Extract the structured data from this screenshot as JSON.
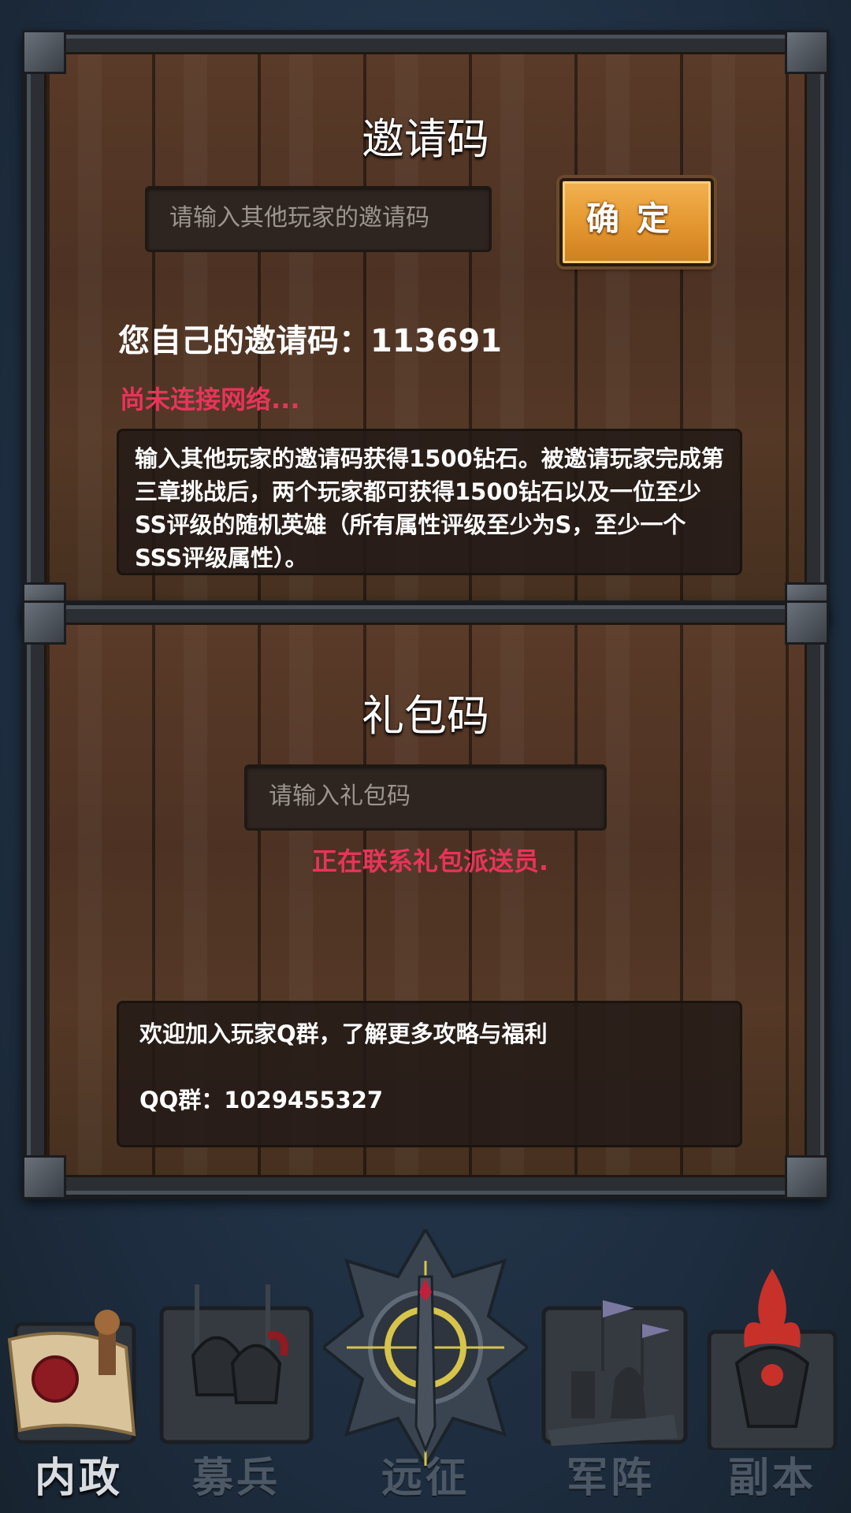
{
  "invite": {
    "title": "邀请码",
    "input_placeholder": "请输入其他玩家的邀请码",
    "confirm_label": "确定",
    "own_code_label": "您自己的邀请码：",
    "own_code_value": "113691",
    "status": "尚未连接网络...",
    "description": "输入其他玩家的邀请码获得1500钻石。被邀请玩家完成第三章挑战后，两个玩家都可获得1500钻石以及一位至少SS评级的随机英雄（所有属性评级至少为S，至少一个SSS评级属性）。"
  },
  "gift": {
    "title": "礼包码",
    "input_placeholder": "请输入礼包码",
    "status": "正在联系礼包派送员.",
    "info_line1": "欢迎加入玩家Q群，了解更多攻略与福利",
    "info_line2": "QQ群：1029455327"
  },
  "bottom_nav": [
    {
      "label": "内政",
      "icon": "scroll-seal-icon",
      "active": true
    },
    {
      "label": "募兵",
      "icon": "helmets-icon",
      "active": false
    },
    {
      "label": "远征",
      "icon": "sword-emblem-icon",
      "active": false
    },
    {
      "label": "军阵",
      "icon": "chess-pieces-icon",
      "active": false
    },
    {
      "label": "副本",
      "icon": "flame-demon-icon",
      "active": false
    }
  ],
  "colors": {
    "status_red": "#e8345a",
    "button_orange": "#e3962f",
    "wood": "#4d3223"
  }
}
